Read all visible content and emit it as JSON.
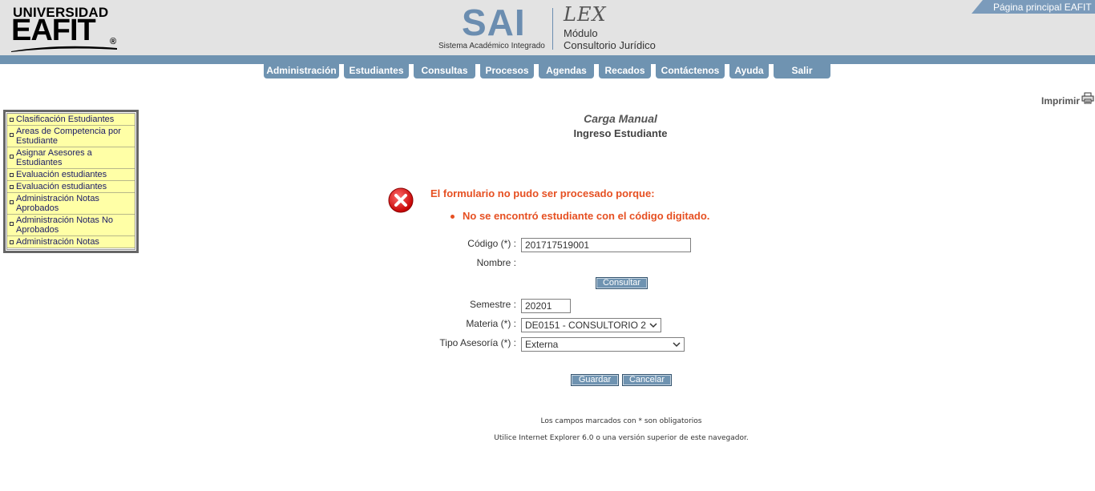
{
  "header": {
    "logo_line1": "UNIVERSIDAD",
    "logo_line2": "EAFIT",
    "logo_reg": "®",
    "sai_title": "SAI",
    "sai_subtitle": "Sistema Académico Integrado",
    "lex_title": "LEX",
    "module_line1": "Módulo",
    "module_line2": "Consultorio Jurídico",
    "main_page_link": "Página principal EAFIT"
  },
  "nav": {
    "tabs": [
      {
        "label": "Administración"
      },
      {
        "label": "Estudiantes"
      },
      {
        "label": "Consultas"
      },
      {
        "label": "Procesos"
      },
      {
        "label": "Agendas"
      },
      {
        "label": "Recados"
      },
      {
        "label": "Contáctenos"
      },
      {
        "label": "Ayuda"
      },
      {
        "label": "Salir"
      }
    ]
  },
  "print_label": "Imprimir",
  "sidebar": {
    "items": [
      {
        "label": "Clasificación Estudiantes"
      },
      {
        "label": "Areas de Competencia por Estudiante"
      },
      {
        "label": "Asignar Asesores a Estudiantes"
      },
      {
        "label": "Evaluación estudiantes"
      },
      {
        "label": "Evaluación estudiantes"
      },
      {
        "label": "Administración Notas Aprobados"
      },
      {
        "label": "Administración Notas No Aprobados"
      },
      {
        "label": "Administración Notas"
      }
    ]
  },
  "page": {
    "title": "Carga Manual",
    "subtitle": "Ingreso Estudiante"
  },
  "error": {
    "heading": "El formulario no pudo ser procesado porque:",
    "messages": [
      "No se encontró estudiante con el código digitado."
    ]
  },
  "form": {
    "codigo_label": "Código (*) :",
    "codigo_value": "201717519001",
    "nombre_label": "Nombre :",
    "consultar_button": "Consultar",
    "semestre_label": "Semestre :",
    "semestre_value": "20201",
    "materia_label": "Materia (*) :",
    "materia_value": "DE0151 - CONSULTORIO 2",
    "tipo_asesoria_label": "Tipo Asesoría (*) :",
    "tipo_asesoria_value": "Externa",
    "guardar_button": "Guardar",
    "cancelar_button": "Cancelar"
  },
  "footer": {
    "required_note": "Los campos marcados con * son obligatorios",
    "browser_note": "Utilice Internet Explorer 6.0 o una versión superior de este navegador."
  },
  "colors": {
    "accent_blue": "#6f93b1",
    "error_orange": "#e65022",
    "sidebar_yellow": "#ffffa6"
  }
}
